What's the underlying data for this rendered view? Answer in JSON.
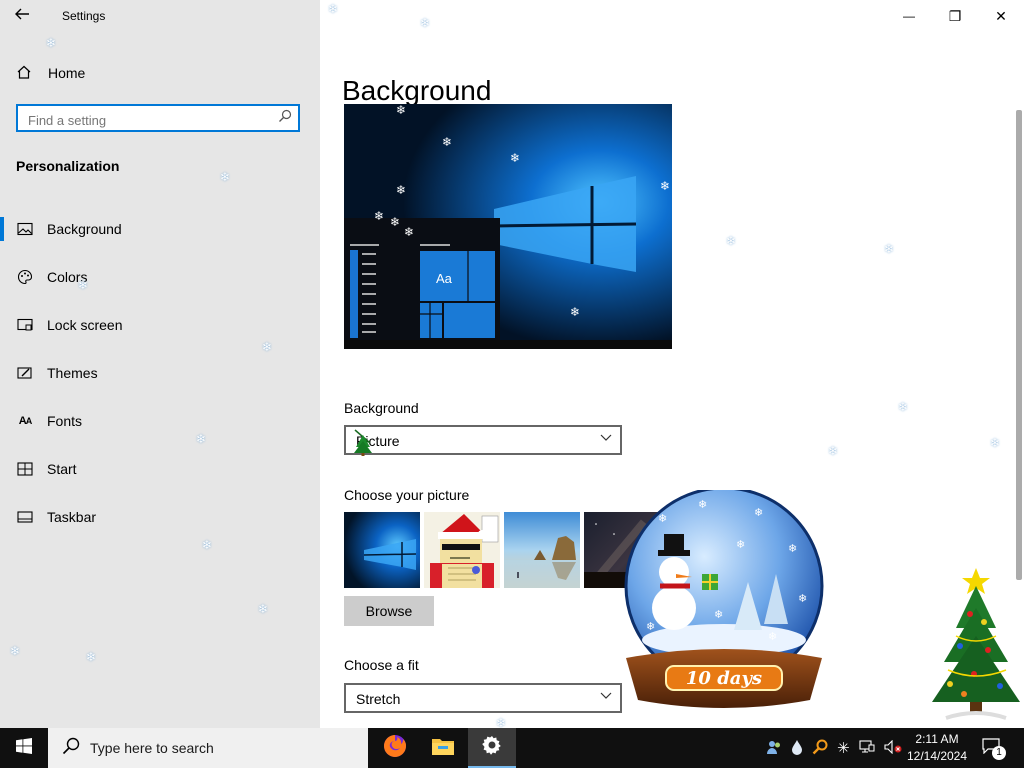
{
  "window": {
    "title": "Settings",
    "minimize_glyph": "—",
    "restore_glyph": "❐",
    "close_glyph": "✕"
  },
  "sidebar": {
    "home_label": "Home",
    "search_placeholder": "Find a setting",
    "section_title": "Personalization",
    "items": [
      {
        "label": "Background",
        "icon": "picture-icon",
        "selected": true
      },
      {
        "label": "Colors",
        "icon": "palette-icon",
        "selected": false
      },
      {
        "label": "Lock screen",
        "icon": "lock-screen-icon",
        "selected": false
      },
      {
        "label": "Themes",
        "icon": "brush-icon",
        "selected": false
      },
      {
        "label": "Fonts",
        "icon": "fonts-icon",
        "selected": false
      },
      {
        "label": "Start",
        "icon": "start-grid-icon",
        "selected": false
      },
      {
        "label": "Taskbar",
        "icon": "taskbar-icon",
        "selected": false
      }
    ]
  },
  "main": {
    "page_title": "Background",
    "preview": {
      "tile_text": "Aa"
    },
    "background_label": "Background",
    "background_value": "Picture",
    "choose_picture_label": "Choose your picture",
    "thumbnails": [
      "windows-hero-thumb",
      "santa-cartoon-thumb",
      "beach-rocks-thumb",
      "night-sky-thumb"
    ],
    "browse_label": "Browse",
    "choose_fit_label": "Choose a fit",
    "fit_value": "Stretch"
  },
  "overlay": {
    "snowglobe_text": "10 days"
  },
  "taskbar": {
    "search_placeholder": "Type here to search",
    "apps": [
      "firefox-icon",
      "file-explorer-icon",
      "settings-icon"
    ],
    "tray_icons": [
      "people-icon",
      "water-drop-icon",
      "search-tool-icon",
      "snowflake-icon",
      "network-icon",
      "volume-muted-icon"
    ],
    "time": "2:11 AM",
    "date": "12/14/2024",
    "notification_count": "1"
  },
  "colors": {
    "accent": "#0078d7",
    "sidebar_bg": "#e6e6e6",
    "taskbar_bg": "#101010"
  }
}
